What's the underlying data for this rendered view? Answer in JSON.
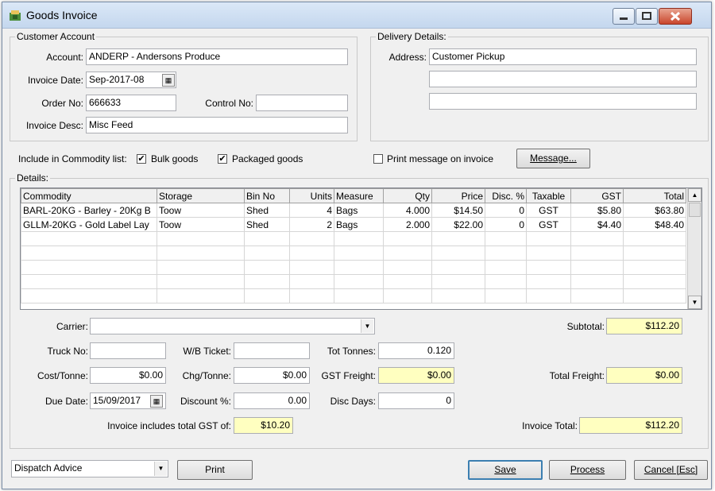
{
  "window": {
    "title": "Goods Invoice"
  },
  "customer": {
    "group_label": "Customer Account",
    "account_label": "Account:",
    "account_value": "ANDERP - Andersons Produce",
    "invoice_date_label": "Invoice Date:",
    "invoice_date_value": "Sep-2017-08",
    "order_no_label": "Order No:",
    "order_no_value": "666633",
    "control_no_label": "Control No:",
    "control_no_value": "",
    "invoice_desc_label": "Invoice Desc:",
    "invoice_desc_value": "Misc Feed"
  },
  "delivery": {
    "group_label": "Delivery Details:",
    "address_label": "Address:",
    "address_lines": [
      "Customer Pickup",
      "",
      ""
    ]
  },
  "options": {
    "include_label": "Include in Commodity list:",
    "bulk_label": "Bulk goods",
    "bulk_checked": "✔",
    "packaged_label": "Packaged goods",
    "packaged_checked": "✔",
    "print_msg_label": "Print message on invoice",
    "message_button": "Message..."
  },
  "details": {
    "group_label": "Details:",
    "columns": [
      "Commodity",
      "Storage",
      "Bin No",
      "Units",
      "Measure",
      "Qty",
      "Price",
      "Disc. %",
      "Taxable",
      "GST",
      "Total"
    ],
    "rows": [
      [
        "BARL-20KG - Barley - 20Kg B",
        "Toow",
        "Shed",
        "4",
        "Bags",
        "4.000",
        "$14.50",
        "0",
        "GST",
        "$5.80",
        "$63.80"
      ],
      [
        "GLLM-20KG - Gold Label Lay",
        "Toow",
        "Shed",
        "2",
        "Bags",
        "2.000",
        "$22.00",
        "0",
        "GST",
        "$4.40",
        "$48.40"
      ]
    ]
  },
  "footer": {
    "carrier_label": "Carrier:",
    "carrier_value": "",
    "subtotal_label": "Subtotal:",
    "subtotal_value": "$112.20",
    "truck_no_label": "Truck No:",
    "truck_no_value": "",
    "wb_ticket_label": "W/B Ticket:",
    "wb_ticket_value": "",
    "tot_tonnes_label": "Tot Tonnes:",
    "tot_tonnes_value": "0.120",
    "cost_tonne_label": "Cost/Tonne:",
    "cost_tonne_value": "$0.00",
    "chg_tonne_label": "Chg/Tonne:",
    "chg_tonne_value": "$0.00",
    "gst_freight_label": "GST Freight:",
    "gst_freight_value": "$0.00",
    "total_freight_label": "Total Freight:",
    "total_freight_value": "$0.00",
    "due_date_label": "Due Date:",
    "due_date_value": "15/09/2017",
    "discount_label": "Discount %:",
    "discount_value": "0.00",
    "disc_days_label": "Disc Days:",
    "disc_days_value": "0",
    "gst_total_label": "Invoice includes total GST of:",
    "gst_total_value": "$10.20",
    "invoice_total_label": "Invoice Total:",
    "invoice_total_value": "$112.20"
  },
  "bottom": {
    "report_select_value": "Dispatch Advice",
    "print_button": "Print",
    "save_button": "Save",
    "process_button": "Process",
    "cancel_button": "Cancel [Esc]"
  },
  "colors": {
    "highlight": "#ffffc0",
    "titlebar": "#c4d7ee",
    "close": "#c9452c"
  },
  "icons": [
    "app-icon",
    "minimize-icon",
    "maximize-icon",
    "close-icon",
    "calendar-icon",
    "chevron-down-icon",
    "scroll-up-icon",
    "scroll-down-icon"
  ]
}
